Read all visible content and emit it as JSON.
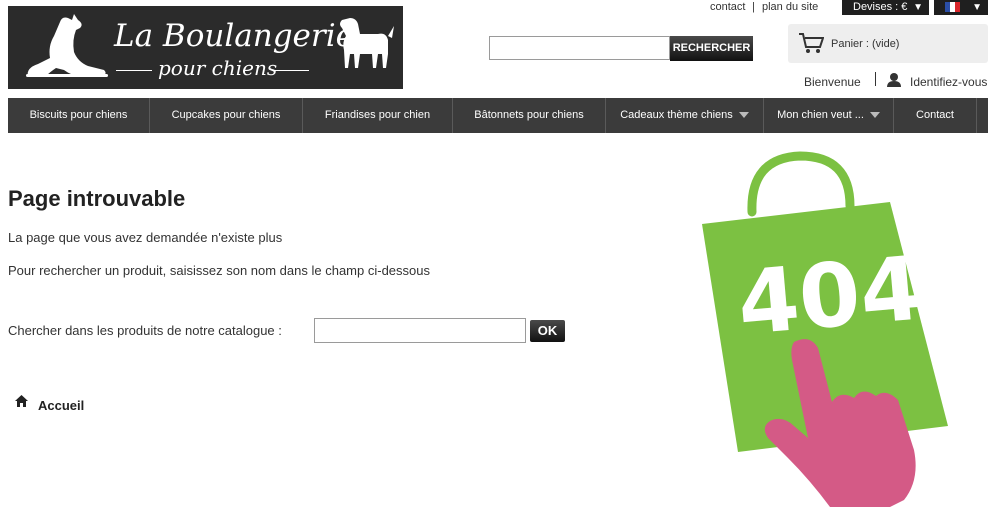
{
  "logo": {
    "line1": "La Boulangerie",
    "line2": "pour chiens"
  },
  "header": {
    "links": [
      "contact",
      "plan du site"
    ],
    "currency_label": "Devises : €",
    "language": "FR",
    "search": {
      "value": "",
      "button": "RECHERCHER"
    },
    "cart_label": "Panier : (vide)",
    "welcome": "Bienvenue",
    "login": "Identifiez-vous"
  },
  "menu": {
    "items": [
      {
        "label": "Biscuits pour chiens",
        "has_dropdown": false
      },
      {
        "label": "Cupcakes pour chiens",
        "has_dropdown": false
      },
      {
        "label": "Friandises pour chien",
        "has_dropdown": false
      },
      {
        "label": "Bâtonnets pour chiens",
        "has_dropdown": false
      },
      {
        "label": "Cadeaux thème chiens",
        "has_dropdown": true
      },
      {
        "label": "Mon chien veut ...",
        "has_dropdown": true
      },
      {
        "label": "Contact",
        "has_dropdown": false
      }
    ]
  },
  "main": {
    "title": "Page introuvable",
    "message1": "La page que vous avez demandée n'existe plus",
    "message2": "Pour rechercher un produit, saisissez son nom dans le champ ci-dessous",
    "search_label": "Chercher dans les produits de notre catalogue :",
    "search_value": "",
    "ok": "OK",
    "home_link": "Accueil",
    "illustration_text": "404"
  },
  "colors": {
    "bag": "#7cc142",
    "hand": "#d45a86",
    "dark": "#3b3b3b"
  }
}
